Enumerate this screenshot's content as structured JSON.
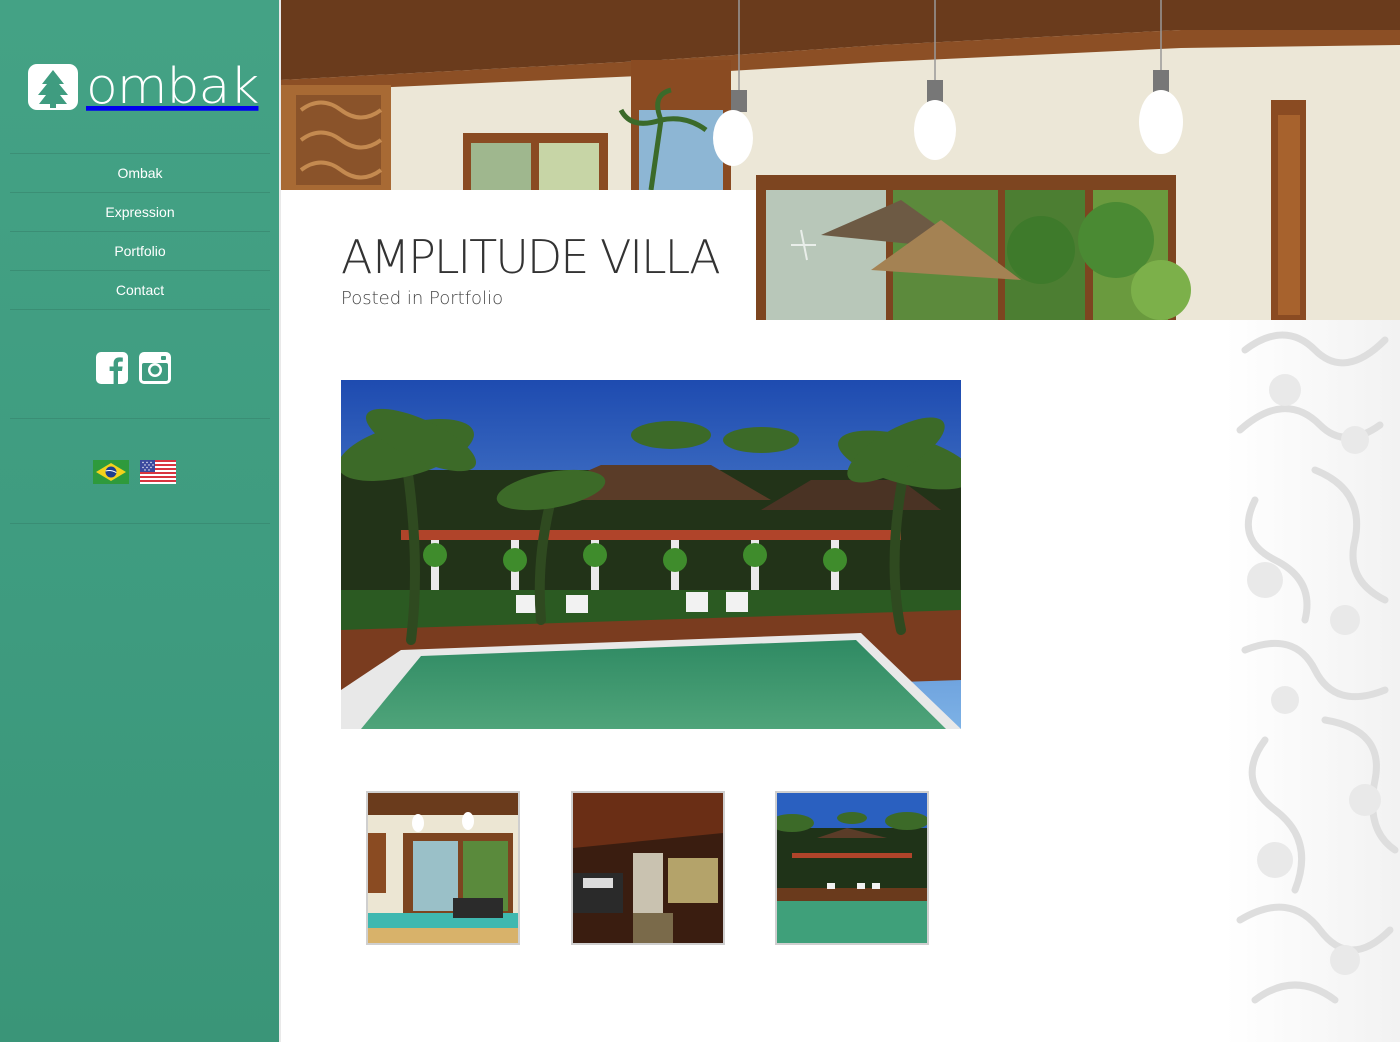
{
  "brand": {
    "name": "ombak"
  },
  "nav": {
    "items": [
      {
        "label": "Ombak"
      },
      {
        "label": "Expression"
      },
      {
        "label": "Portfolio"
      },
      {
        "label": "Contact"
      }
    ]
  },
  "social": [
    {
      "icon": "facebook-icon"
    },
    {
      "icon": "instagram-icon"
    }
  ],
  "languages": [
    {
      "icon": "brazil-flag-icon"
    },
    {
      "icon": "usa-flag-icon"
    }
  ],
  "post": {
    "title": "AMPLITUDE VILLA",
    "meta_prefix": "Posted in",
    "category": "Portfolio"
  },
  "gallery": {
    "main_image": "villa-pool-render",
    "thumbnails": [
      {
        "name": "interior-living-room"
      },
      {
        "name": "interior-bathroom"
      },
      {
        "name": "pool-garden"
      }
    ]
  },
  "colors": {
    "sidebar": "#3f9c80",
    "accent": "#ffffff",
    "title_text": "#333333"
  }
}
